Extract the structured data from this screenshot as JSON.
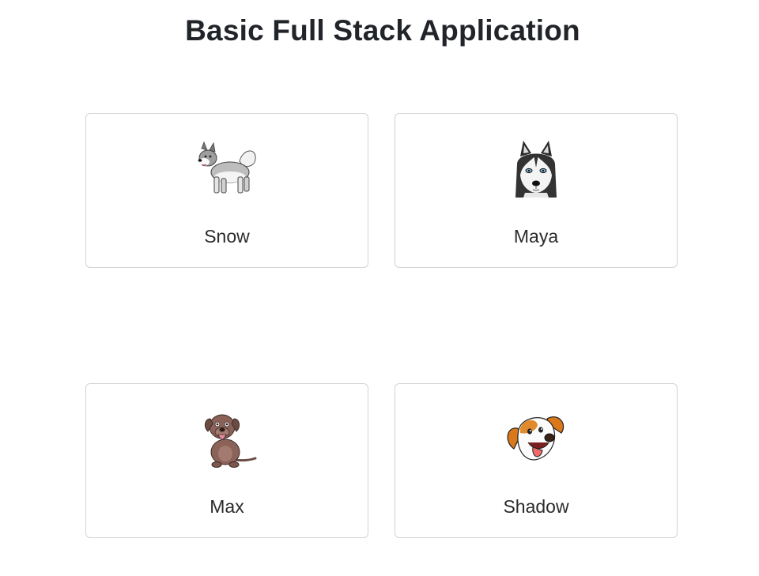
{
  "page": {
    "title": "Basic Full Stack Application"
  },
  "dogs": [
    {
      "name": "Snow",
      "icon": "malamute-dog-icon"
    },
    {
      "name": "Maya",
      "icon": "husky-dog-icon"
    },
    {
      "name": "Max",
      "icon": "brown-dog-icon"
    },
    {
      "name": "Shadow",
      "icon": "beagle-dog-icon"
    }
  ]
}
